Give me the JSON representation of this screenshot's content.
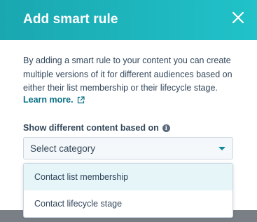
{
  "modal": {
    "title": "Add smart rule",
    "description": "By adding a smart rule to your content you can create multiple versions of it for different audiences based on either their list membership or their lifecycle stage.",
    "learn_more": "Learn more.",
    "field_label": "Show different content based on",
    "select": {
      "value": "Select category",
      "options": [
        "Contact list membership",
        "Contact lifecycle stage"
      ]
    }
  },
  "icons": {
    "close": "close-icon",
    "external_link": "external-link-icon",
    "info": "info-icon",
    "caret": "caret-down-icon"
  },
  "colors": {
    "header_gradient_start": "#1aa7b0",
    "header_gradient_end": "#21c2c9",
    "link": "#0a6f85",
    "text": "#33475b",
    "option_highlight": "#e5f5f8"
  }
}
